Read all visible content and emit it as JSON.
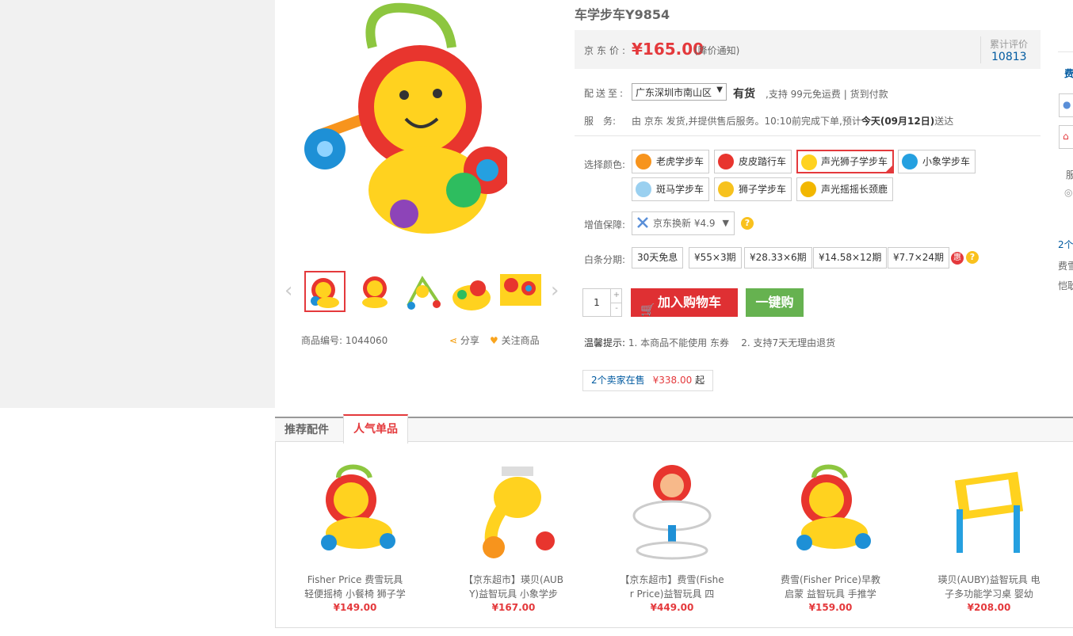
{
  "product": {
    "title": "车学步车Y9854",
    "price_label": "京东价:",
    "price": "¥165.00",
    "price_notify": "(降价通知)",
    "review_label": "累计评价",
    "review_count": "10813",
    "sku_label": "商品编号:",
    "sku": "1044060",
    "share": "分享",
    "follow": "关注商品"
  },
  "delivery": {
    "label": "配送至:",
    "region": "广东深圳市南山区",
    "stock": "有货",
    "note": ",支持 99元免运费 | 货到付款"
  },
  "service": {
    "label": "服　务:",
    "text_pre": "由 京东 发货,并提供售后服务。10:10前完成下单,预计",
    "text_bold": "今天(09月12日)",
    "text_post": "送达"
  },
  "colors": {
    "label": "选择颜色:",
    "options": [
      "老虎学步车",
      "皮皮踏行车",
      "声光狮子学步车",
      "小象学步车",
      "斑马学步车",
      "狮子学步车",
      "声光摇摇长颈鹿"
    ],
    "selected": "声光狮子学步车"
  },
  "insurance": {
    "label": "增值保障:",
    "option": "京东换新 ¥4.9"
  },
  "installment": {
    "label": "白条分期:",
    "options": [
      "30天免息",
      "¥55×3期",
      "¥28.33×6期",
      "¥14.58×12期",
      "¥7.7×24期"
    ],
    "badge": "惠"
  },
  "purchase": {
    "qty": "1",
    "plus": "+",
    "minus": "-",
    "cart": "加入购物车",
    "buy_now": "一键购"
  },
  "tips": {
    "label": "温馨提示:",
    "item1": "1.  本商品不能使用  东券",
    "item2": "2.  支持7天无理由退货"
  },
  "sellers": {
    "text": "2个卖家在售",
    "price": "¥338.00",
    "suffix": "起"
  },
  "right_column": {
    "t1": "费",
    "t2": "服",
    "t3": "2个",
    "t4": "费雪",
    "t5": "恺耿"
  },
  "tabs": [
    "推荐配件",
    "人气单品"
  ],
  "active_tab": "人气单品",
  "products": [
    {
      "name": "Fisher Price 费雪玩具 轻便摇椅 小餐椅 狮子学",
      "price": "¥149.00"
    },
    {
      "name": "【京东超市】瑛贝(AUBY)益智玩具 小象学步",
      "price": "¥167.00"
    },
    {
      "name": "【京东超市】费雪(Fisher Price)益智玩具 四",
      "price": "¥449.00"
    },
    {
      "name": "费雪(Fisher Price)早教启蒙 益智玩具 手推学",
      "price": "¥159.00"
    },
    {
      "name": "瑛贝(AUBY)益智玩具 电子多功能学习桌 婴幼",
      "price": "¥208.00"
    }
  ],
  "colors_palette": {
    "accent": "#e4393c",
    "buy_green": "#66b250",
    "link_blue": "#005aa0"
  }
}
